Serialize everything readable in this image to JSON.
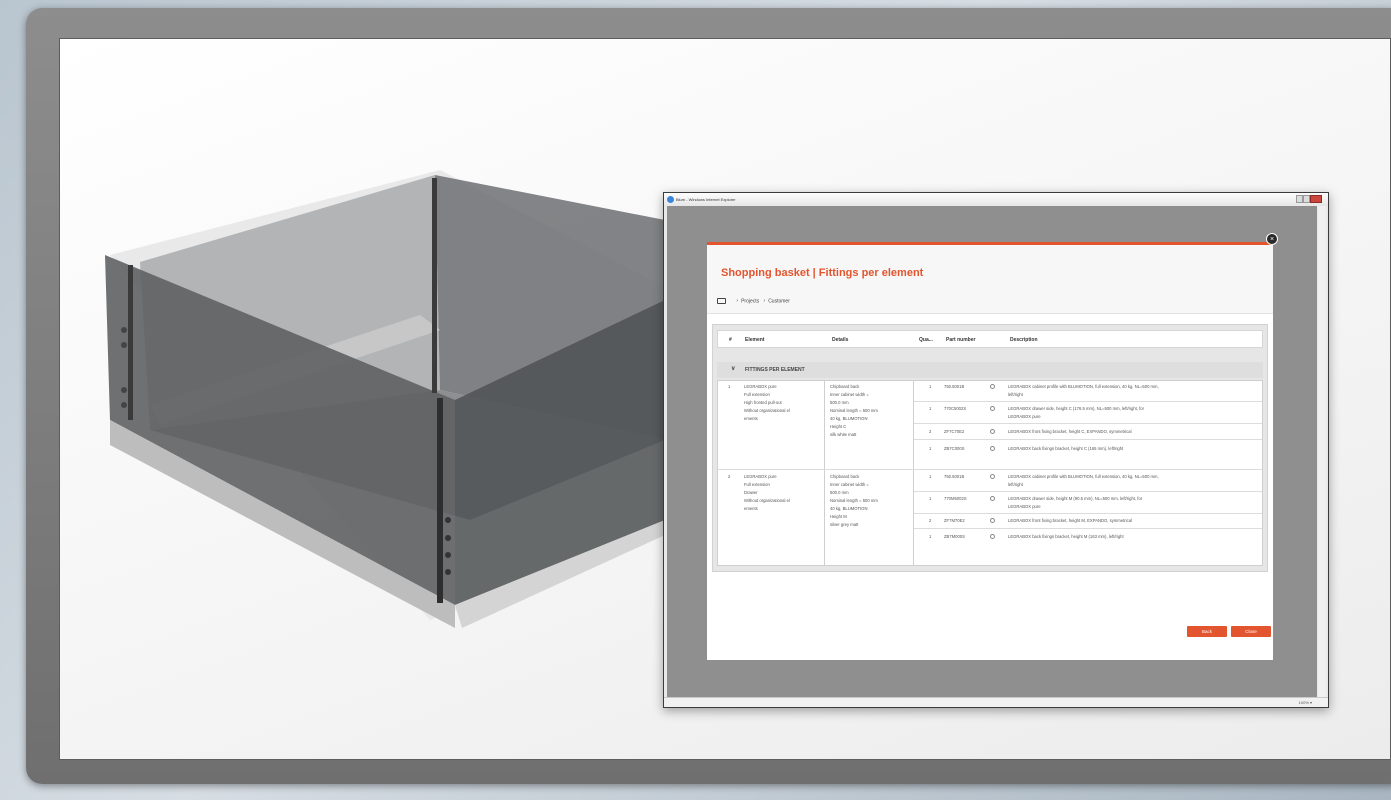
{
  "browser": {
    "title": "Blum - Windows Internet Explorer",
    "zoom": "100%"
  },
  "dialog": {
    "title": "Shopping basket | Fittings per element",
    "breadcrumbs": [
      "Projects",
      "Customer"
    ],
    "columns": [
      "#",
      "Element",
      "Details",
      "Qua...",
      "Part number",
      "Description"
    ],
    "group_label": "FITTINGS PER ELEMENT",
    "elements": [
      {
        "num": "1",
        "element": [
          "LEGRABOX pure",
          "Full extension",
          "High fronted pull-out",
          "Without organizational el",
          "ements"
        ],
        "details": [
          "Chipboard back",
          "Inner cabinet width =",
          "500.0 mm",
          "Nominal length = 500 mm",
          "40 kg, BLUMOTION",
          "Height C",
          "silk white matt"
        ],
        "parts": [
          {
            "qty": "1",
            "part": "750.5001B",
            "desc": [
              "LEGRABOX cabinet profile with BLUMOTION, full extension, 40 kg, NL=500 mm,",
              "left/right"
            ]
          },
          {
            "qty": "1",
            "part": "770C5002S",
            "desc": [
              "LEGRABOX drawer side, height C (176.5 mm), NL=500 mm, left/right, for",
              "LEGRABOX pure"
            ]
          },
          {
            "qty": "2",
            "part": "ZF7C70E2",
            "desc": [
              "LEGRABOX front fixing bracket, height C, EXPANDO, symmetrical"
            ]
          },
          {
            "qty": "1",
            "part": "ZB7C000S",
            "desc": [
              "LEGRABOX back fixings bracket, height C (165 mm), left/right"
            ]
          }
        ]
      },
      {
        "num": "2",
        "element": [
          "LEGRABOX pure",
          "Full extension",
          "Drawer",
          "Without organizational el",
          "ements"
        ],
        "details": [
          "Chipboard back",
          "Inner cabinet width =",
          "500.0 mm",
          "Nominal length = 500 mm",
          "40 kg, BLUMOTION",
          "Height M",
          "silver grey matt"
        ],
        "parts": [
          {
            "qty": "1",
            "part": "750.5001B",
            "desc": [
              "LEGRABOX cabinet profile with BLUMOTION, full extension, 40 kg, NL=500 mm,",
              "left/right"
            ]
          },
          {
            "qty": "1",
            "part": "770M5002S",
            "desc": [
              "LEGRABOX drawer side, height M (90.5 mm), NL=500 mm, left/right, for",
              "LEGRABOX pure"
            ]
          },
          {
            "qty": "2",
            "part": "ZF7M70E2",
            "desc": [
              "LEGRABOX front fixing bracket, height M, EXPANDO, symmetrical"
            ]
          },
          {
            "qty": "1",
            "part": "ZB7M000S",
            "desc": [
              "LEGRABOX back fixings bracket, height M (163 mm), left/right"
            ]
          }
        ]
      }
    ],
    "buttons": {
      "back": "Back",
      "close": "Close"
    }
  }
}
